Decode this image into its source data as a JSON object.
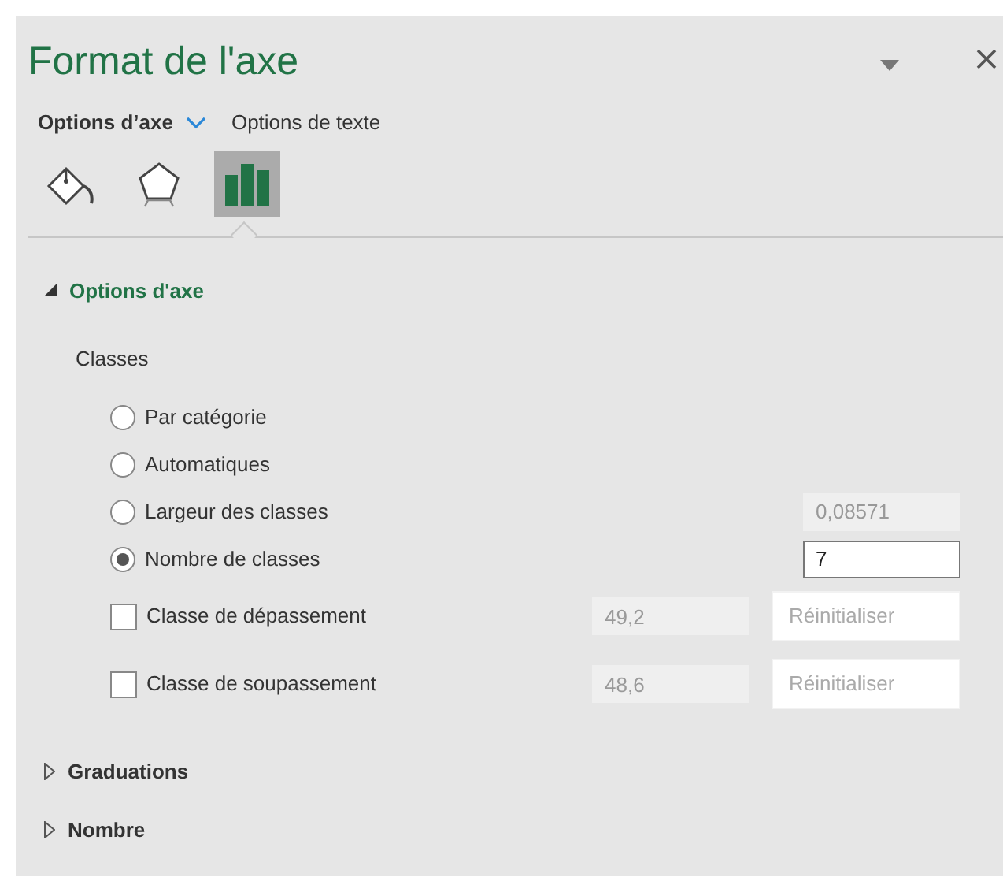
{
  "panel": {
    "title": "Format de l'axe",
    "tabs": [
      {
        "label": "Options d’axe",
        "selected": true
      },
      {
        "label": "Options de texte",
        "selected": false
      }
    ],
    "icon_tabs": [
      {
        "kind": "fill",
        "selected": false
      },
      {
        "kind": "shape",
        "selected": false
      },
      {
        "kind": "bars",
        "selected": true
      }
    ],
    "sections": [
      {
        "title": "Options d'axe",
        "expanded": true,
        "group_label": "Classes",
        "options": [
          {
            "kind": "radio",
            "label": "Par catégorie",
            "selected": false
          },
          {
            "kind": "radio",
            "label": "Automatiques",
            "selected": false
          },
          {
            "kind": "radio",
            "label": "Largeur des classes",
            "selected": false,
            "field": {
              "value": "0,08571",
              "disabled": true
            }
          },
          {
            "kind": "radio",
            "label": "Nombre de classes",
            "selected": true,
            "field": {
              "value": "7",
              "disabled": false
            }
          },
          {
            "kind": "checkbox",
            "label": "Classe de dépassement",
            "checked": false,
            "field": {
              "value": "49,2",
              "disabled": true
            },
            "button": {
              "label": "Réinitialiser",
              "disabled": true
            }
          },
          {
            "kind": "checkbox",
            "label": "Classe de soupassement",
            "checked": false,
            "field": {
              "value": "48,6",
              "disabled": true
            },
            "button": {
              "label": "Réinitialiser",
              "disabled": true
            }
          }
        ]
      },
      {
        "title": "Graduations",
        "expanded": false
      },
      {
        "title": "Nombre",
        "expanded": false
      }
    ]
  }
}
